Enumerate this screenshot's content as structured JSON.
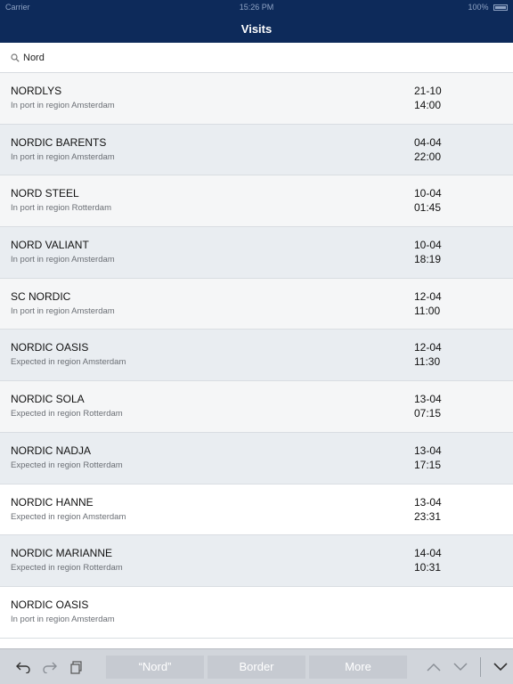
{
  "status_bar": {
    "carrier": "Carrier",
    "time": "15:26 PM",
    "battery": "100%"
  },
  "nav": {
    "title": "Visits"
  },
  "search": {
    "value": "Nord",
    "placeholder": ""
  },
  "visits": [
    {
      "name": "NORDLYS",
      "status": "In port in region Amsterdam",
      "date": "21-10",
      "time": "14:00"
    },
    {
      "name": "NORDIC BARENTS",
      "status": "In port in region Amsterdam",
      "date": "04-04",
      "time": "22:00"
    },
    {
      "name": "NORD STEEL",
      "status": "In port in region Rotterdam",
      "date": "10-04",
      "time": "01:45"
    },
    {
      "name": "NORD VALIANT",
      "status": "In port in region Amsterdam",
      "date": "10-04",
      "time": "18:19"
    },
    {
      "name": "SC NORDIC",
      "status": "In port in region Amsterdam",
      "date": "12-04",
      "time": "11:00"
    },
    {
      "name": "NORDIC OASIS",
      "status": "Expected in region Amsterdam",
      "date": "12-04",
      "time": "11:30"
    },
    {
      "name": "NORDIC SOLA",
      "status": "Expected in region Rotterdam",
      "date": "13-04",
      "time": "07:15"
    },
    {
      "name": "NORDIC NADJA",
      "status": "Expected in region Rotterdam",
      "date": "13-04",
      "time": "17:15"
    },
    {
      "name": "NORDIC HANNE",
      "status": "Expected in region Amsterdam",
      "date": "13-04",
      "time": "23:31"
    },
    {
      "name": "NORDIC MARIANNE",
      "status": "Expected in region Rotterdam",
      "date": "14-04",
      "time": "10:31"
    },
    {
      "name": "NORDIC OASIS",
      "status": "In port in region Amsterdam",
      "date": "",
      "time": ""
    }
  ],
  "keyboard": {
    "suggestions": [
      "“Nord”",
      "Border",
      "More"
    ]
  },
  "colors": {
    "nav_bg": "#0d2a5a",
    "row_odd": "#f5f6f7",
    "row_even": "#e9edf1",
    "keyboard_bg": "#d1d5db"
  }
}
